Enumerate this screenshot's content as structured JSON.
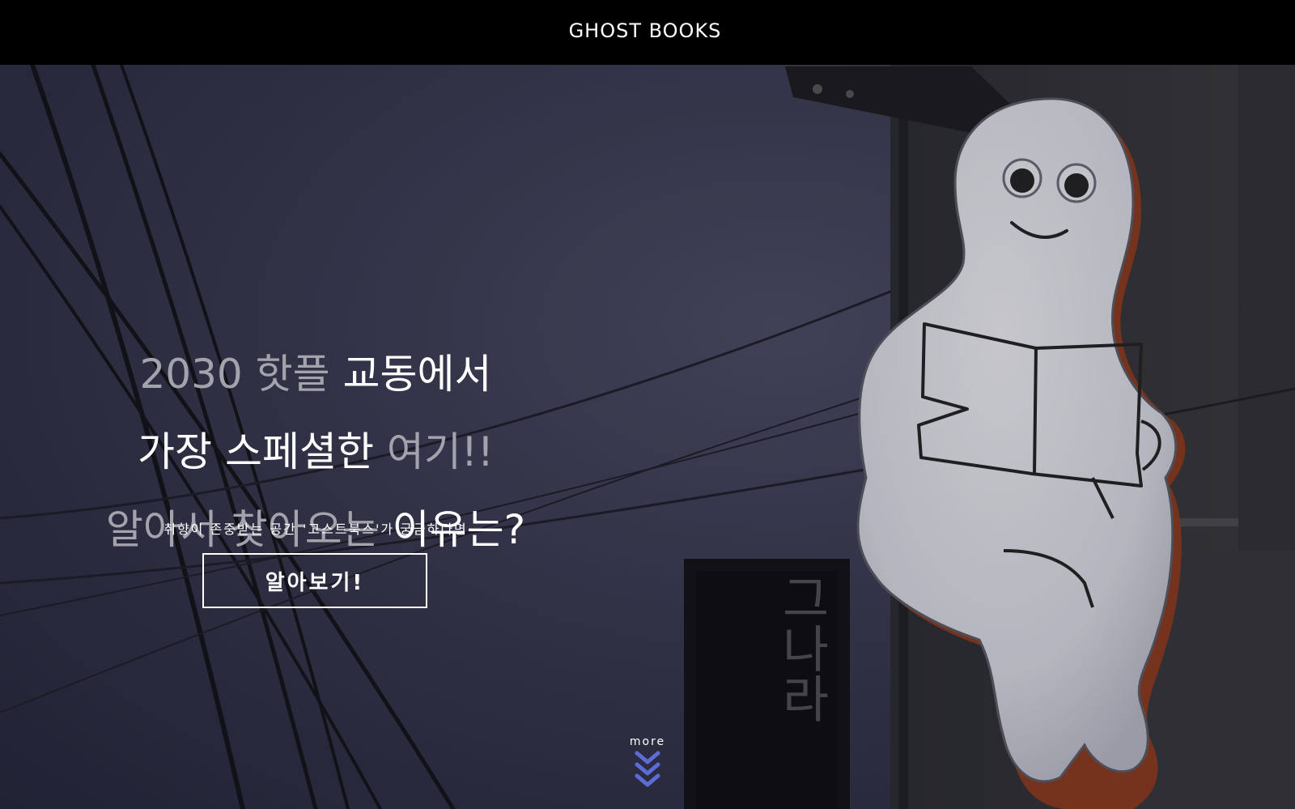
{
  "header": {
    "logo_text": "GHOST BOOKS"
  },
  "hero": {
    "headline": {
      "line1": {
        "dim": "2030 핫플 ",
        "bright": "교동에서"
      },
      "line2": {
        "bright": "가장 스페셜한 ",
        "dim": "여기!!"
      },
      "line3": {
        "dim": "알아서 찾아오는 ",
        "bright": "이유는?"
      }
    },
    "subtext": "취향이 존중받는 공간 '고스트북스'가 궁금하다면",
    "cta_label": "알아보기!",
    "sign_text": "그나라"
  },
  "scroll": {
    "more_label": "more",
    "chevron_color": "#5b6cd6"
  },
  "colors": {
    "background": "#000000",
    "sky": "#3b3b53",
    "headline_dim": "#a3a3ad",
    "headline_bright": "#ffffff"
  },
  "icons": {
    "scroll_indicator": "triple-chevron-down-icon"
  }
}
